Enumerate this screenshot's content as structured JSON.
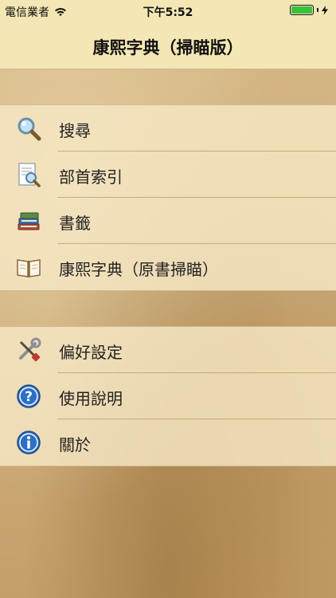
{
  "status": {
    "carrier": "電信業者",
    "time": "下午5:52",
    "wifi_icon": "wifi-icon",
    "battery_icon": "battery-icon",
    "charging_icon": "charging-bolt-icon",
    "battery_color": "#39c23d"
  },
  "navbar": {
    "title": "康熙字典（掃瞄版）"
  },
  "menu": {
    "group1": [
      {
        "label": "搜尋",
        "icon": "magnifier-icon"
      },
      {
        "label": "部首索引",
        "icon": "index-document-icon"
      },
      {
        "label": "書籤",
        "icon": "books-icon"
      },
      {
        "label": "康熙字典（原書掃瞄）",
        "icon": "open-book-icon"
      }
    ],
    "group2": [
      {
        "label": "偏好設定",
        "icon": "tools-icon"
      },
      {
        "label": "使用說明",
        "icon": "help-icon"
      },
      {
        "label": "關於",
        "icon": "info-icon"
      }
    ]
  }
}
